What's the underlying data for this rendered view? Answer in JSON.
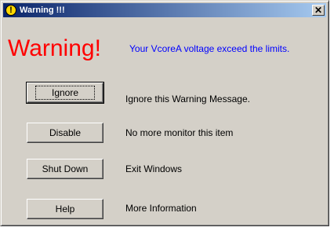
{
  "window": {
    "title": "Warning !!!",
    "close_label": "✕",
    "warning_icon_glyph": "!"
  },
  "message": {
    "headline": "Warning!",
    "detail": "Your VcoreA voltage exceed the limits."
  },
  "actions": [
    {
      "button": "Ignore",
      "description": "Ignore this Warning Message."
    },
    {
      "button": "Disable",
      "description": "No more monitor this item"
    },
    {
      "button": "Shut Down",
      "description": "Exit Windows"
    },
    {
      "button": "Help",
      "description": "More Information"
    }
  ],
  "colors": {
    "headline": "#ff0000",
    "detail": "#0000ff",
    "titlebar_start": "#0a246a",
    "titlebar_end": "#a6caf0",
    "face": "#d4d0c8"
  },
  "icons": {
    "title_icon": "warning-icon",
    "close_icon": "close-icon"
  }
}
